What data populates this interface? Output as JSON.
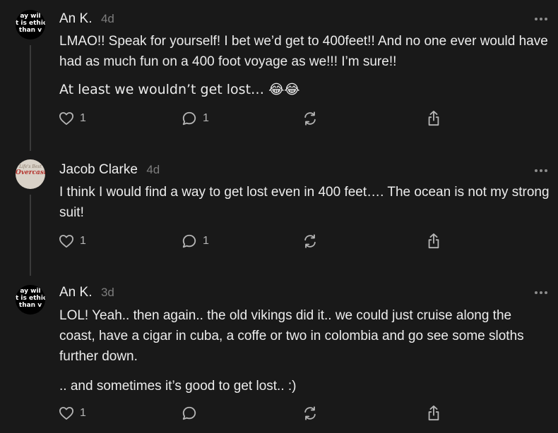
{
  "comments": [
    {
      "avatar": {
        "lines": [
          "ay wil",
          "t is ethic",
          "than v"
        ],
        "icon": "quote-profile-avatar"
      },
      "author": "An K.",
      "time": "4d",
      "paragraphs": [
        "LMAO!! Speak for yourself! I bet we’d get to 400feet!! And no one ever would have had as much fun on a 400 foot voyage as we!!! I’m sure!!",
        "At least we wouldn’t get lost… 😂😂"
      ],
      "likes": "1",
      "replies": "1"
    },
    {
      "avatar": {
        "script_top": "Life's Best",
        "script": "Overcast",
        "icon": "logo-profile-avatar"
      },
      "author": "Jacob Clarke",
      "time": "4d",
      "paragraphs": [
        "I think I would find a way to get lost even in 400 feet…. The ocean is not my strong suit!"
      ],
      "likes": "1",
      "replies": "1"
    },
    {
      "avatar": {
        "lines": [
          "ay wil",
          "t is ethic",
          "than v"
        ],
        "icon": "quote-profile-avatar"
      },
      "author": "An K.",
      "time": "3d",
      "paragraphs": [
        "LOL! Yeah.. then again.. the old vikings did it.. we could just cruise along the coast, have a cigar in cuba, a coffe or two in colombia and go see some sloths further down.",
        ".. and sometimes it’s good to get lost.. :)"
      ],
      "likes": "1",
      "replies": ""
    }
  ],
  "icons": {
    "like": "heart-icon",
    "reply": "speech-bubble-icon",
    "restack": "restack-icon",
    "share": "share-icon",
    "more": "more-dots-icon"
  },
  "colors": {
    "background": "#191919",
    "text": "#ececec",
    "muted": "#7d7d7d",
    "icon": "#b5b5b5",
    "thread_line": "#3a3a3a"
  }
}
